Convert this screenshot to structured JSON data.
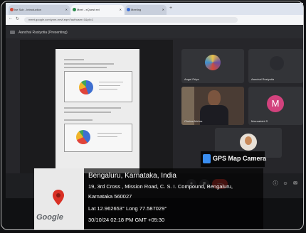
{
  "browser": {
    "tabs": [
      {
        "label": "Ise Sub - Introduction",
        "active": false,
        "color": "#d24a3a"
      },
      {
        "label": "Meet - eQuest ext",
        "active": true,
        "color": "#2a8a4a"
      },
      {
        "label": "Meeting",
        "active": false,
        "color": "#3a6ed8"
      }
    ],
    "url": "meet.google.com/ynm-mrvf-eqm?authuser=1&pli=1"
  },
  "meet": {
    "presenter_tag": "Aanchal Rusiyotia (Presenting)",
    "participants": [
      {
        "name": "Angel Priya"
      },
      {
        "name": "Aanchal Rusiyotia"
      },
      {
        "name": "Chetna Mehra"
      },
      {
        "name": "Meenakshi S"
      },
      {
        "name": ""
      }
    ],
    "m_initial": "M"
  },
  "gps": {
    "app_title": "GPS Map Camera",
    "place": "Bengaluru, Karnataka, India",
    "address_line1": "19, 3rd Cross , Mission Road, C. S. I. Compound, Bengaluru,",
    "address_line2": "Karnataka 560027",
    "coords": "Lat 12.962653° Long 77.587029°",
    "datetime": "30/10/24 02:18 PM GMT +05:30",
    "map_brand": "Google"
  }
}
